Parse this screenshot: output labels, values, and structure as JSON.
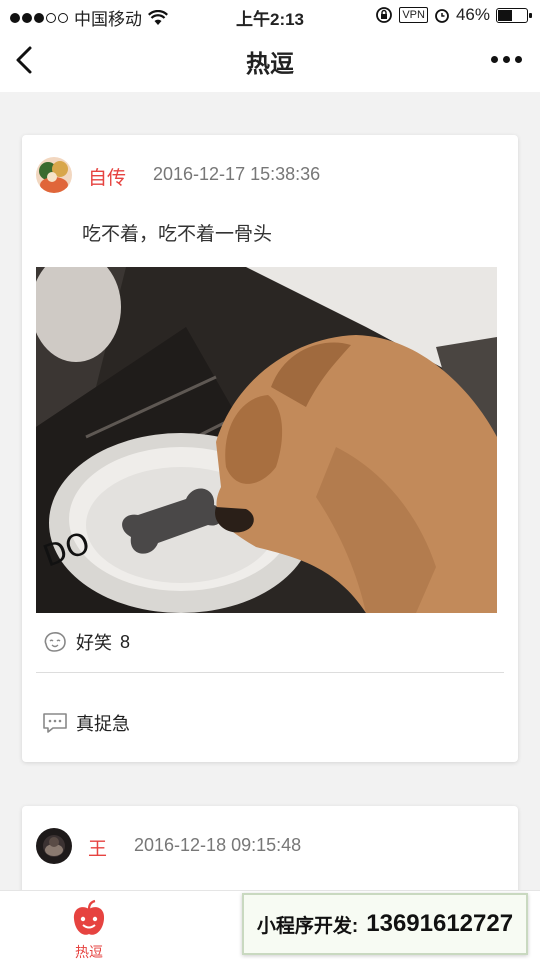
{
  "status_bar": {
    "carrier": "中国移动",
    "time": "上午2:13",
    "vpn": "VPN",
    "battery": "46%"
  },
  "nav": {
    "title": "热逗"
  },
  "posts": [
    {
      "username": "自传",
      "datetime": "2016-12-17 15:38:36",
      "text": "吃不着，吃不着一骨头",
      "funny_label": "好笑",
      "funny_count": "8",
      "comment_text": "真捉急"
    },
    {
      "username": "王",
      "datetime": "2016-12-18 09:15:48"
    }
  ],
  "tabbar": {
    "tabs": [
      {
        "label": "热逗",
        "active": true
      }
    ]
  },
  "promo": {
    "label": "小程序开发:",
    "phone": "13691612727"
  },
  "colors": {
    "accent": "#e64340"
  }
}
